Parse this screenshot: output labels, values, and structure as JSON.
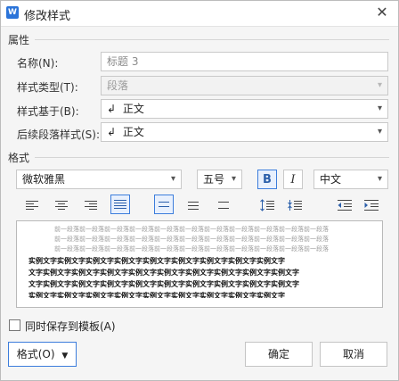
{
  "dialog": {
    "title": "修改样式",
    "app_icon": "W"
  },
  "properties": {
    "section_title": "属性",
    "name_label": "名称(N):",
    "name_value": "标题 3",
    "style_type_label": "样式类型(T):",
    "style_type_value": "段落",
    "based_on_label": "样式基于(B):",
    "based_on_value": "正文",
    "next_style_label": "后续段落样式(S):",
    "next_style_value": "正文",
    "return_glyph": "↲"
  },
  "format": {
    "section_title": "格式",
    "font_family": "微软雅黑",
    "font_size": "五号",
    "bold_label": "B",
    "italic_label": "I",
    "language": "中文"
  },
  "preview": {
    "gray_lines": [
      "前一段落前一段落前一段落前一段落前一段落前一段落前一段落前一段落前一段落前一段落前一段落",
      "前一段落前一段落前一段落前一段落前一段落前一段落前一段落前一段落前一段落前一段落前一段落",
      "前一段落前一段落前一段落前一段落前一段落前一段落前一段落前一段落前一段落前一段落前一段落"
    ],
    "sample_lines": [
      "实例文字实例文字实例文字实例文字实例文字实例文字实例文字实例文字实例文字",
      "文字实例文字实例文字实例文字实例文字实例文字实例文字实例文字实例文字实例文字",
      "文字实例文字实例文字实例文字实例文字实例文字实例文字实例文字实例文字实例文字",
      "实例文字实例文字实例文字实例文字实例文字实例文字实例文字实例文字实例文字"
    ]
  },
  "footer": {
    "save_to_template_label": "同时保存到模板(A)",
    "save_to_template_checked": false,
    "format_button_label": "格式(O)",
    "ok_label": "确定",
    "cancel_label": "取消"
  },
  "colors": {
    "accent": "#3c7ddc",
    "app_icon": "#2b74d9"
  }
}
